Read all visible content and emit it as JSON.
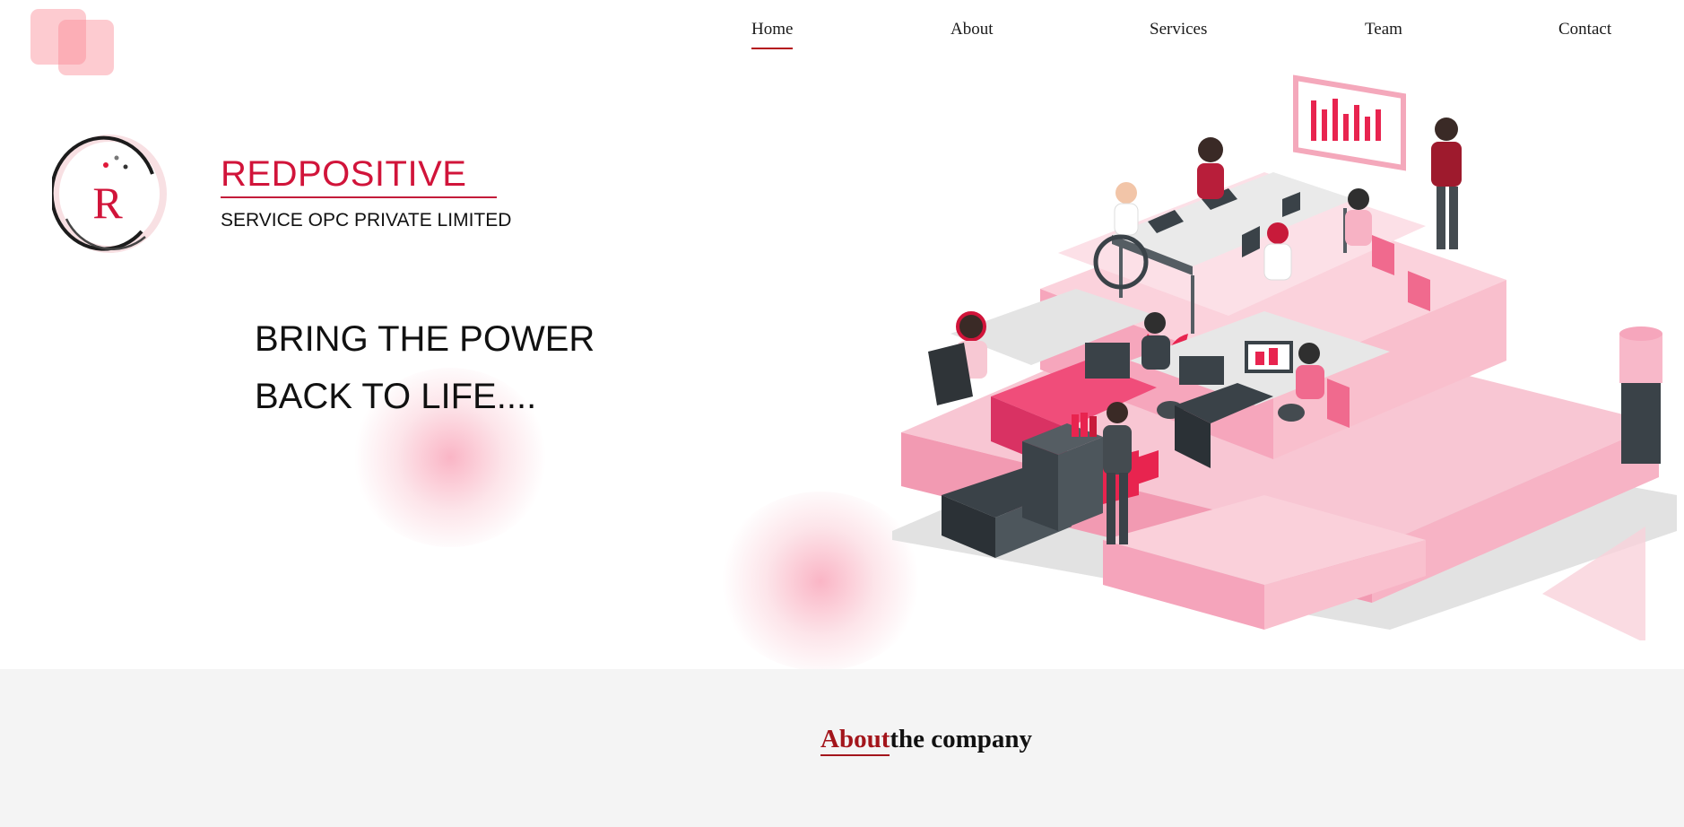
{
  "nav": {
    "items": [
      {
        "label": "Home",
        "active": true
      },
      {
        "label": "About",
        "active": false
      },
      {
        "label": "Services",
        "active": false
      },
      {
        "label": "Team",
        "active": false
      },
      {
        "label": "Contact",
        "active": false
      }
    ]
  },
  "brand": {
    "logo_letter": "R",
    "name": "REDPOSITIVE",
    "subtitle": "SERVICE OPC PRIVATE LIMITED"
  },
  "hero": {
    "tagline_line1": "BRING THE POWER",
    "tagline_line2": "BACK TO LIFE....",
    "illustration_icon": "office-team-illustration"
  },
  "about": {
    "title_accent": "About",
    "title_rest": "the company"
  },
  "colors": {
    "brand_red": "#d1143a",
    "accent_dark_red": "#a3151b",
    "pink_soft": "#f7a1b3"
  }
}
